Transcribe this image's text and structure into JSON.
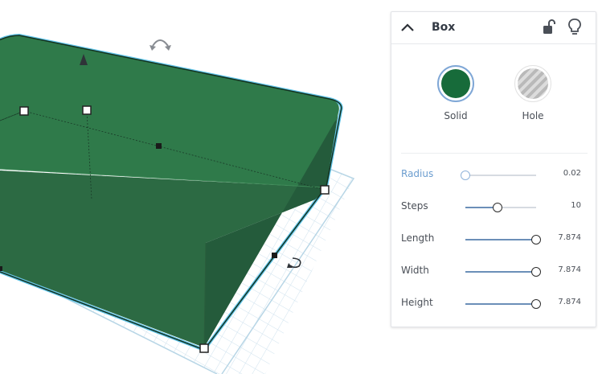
{
  "panel": {
    "title": "Box",
    "shape_options": [
      {
        "label": "Solid",
        "color": "#176b3a",
        "selected": true
      },
      {
        "label": "Hole",
        "selected": false
      }
    ],
    "properties": [
      {
        "label": "Radius",
        "value": "0.02",
        "level": 0.0
      },
      {
        "label": "Steps",
        "value": "10",
        "level": 0.45
      },
      {
        "label": "Length",
        "value": "7.874",
        "level": 1.0
      },
      {
        "label": "Width",
        "value": "7.874",
        "level": 1.0
      },
      {
        "label": "Height",
        "value": "7.874",
        "level": 1.0
      }
    ]
  },
  "colors": {
    "box_front": "#2b6b42",
    "box_top": "#2f7a4a",
    "box_side": "#22583a",
    "selection_outline": "#5fc4e8",
    "workplane_grid": "#cde3ee",
    "accent_blue": "#6b9dcf"
  }
}
